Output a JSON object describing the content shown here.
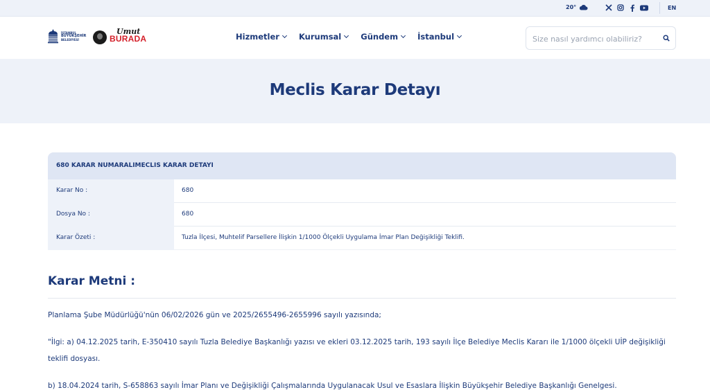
{
  "topbar": {
    "temperature": "20°",
    "weather_icon": "cloud-icon",
    "social_icons": [
      "x-icon",
      "instagram-icon",
      "facebook-icon",
      "youtube-icon"
    ],
    "language": "EN"
  },
  "header": {
    "logo_line1": "İSTANBUL",
    "logo_line2": "BÜYÜKŞEHİR",
    "logo_line3": "BELEDİYESİ",
    "brand_top": "Umut",
    "brand_bottom": "BURADA",
    "nav": [
      "Hizmetler",
      "Kurumsal",
      "Gündem",
      "İstanbul"
    ],
    "search_placeholder": "Size nasıl yardımcı olabiliriz?"
  },
  "hero": {
    "title": "Meclis Karar Detayı"
  },
  "decision": {
    "heading": "680 KARAR NUMARALIMECLIS KARAR DETAYI",
    "rows": [
      {
        "label": "Karar No :",
        "value": "680"
      },
      {
        "label": "Dosya No :",
        "value": "680"
      },
      {
        "label": "Karar Özeti :",
        "value": "Tuzla İlçesi, Muhtelif Parsellere İlişkin 1/1000 Ölçekli Uygulama İmar Plan Değişikliği Teklifi."
      }
    ]
  },
  "text": {
    "title": "Karar Metni :",
    "p1": "Planlama Şube Müdürlüğü'nün 06/02/2026 gün ve 2025/2655496-2655996 sayılı yazısında;",
    "p2": "\"İlgi: a) 04.12.2025 tarih, E-350410 sayılı Tuzla Belediye Başkanlığı yazısı ve ekleri 03.12.2025 tarih, 193 sayılı İlçe Belediye Meclis Kararı ile 1/1000 ölçekli UİP değişikliği teklifi dosyası.",
    "p3": "b) 18.04.2024 tarih, S-658863 sayılı İmar Planı ve Değişikliği Çalışmalarında Uygulanacak Usul ve Esaslara İlişkin Büyükşehir Belediye Başkanlığı Genelgesi."
  },
  "colors": {
    "primary": "#1d3a7a",
    "hero_bg": "#eef2f9",
    "table_head": "#dfe6f4",
    "brand_red": "#d4202a"
  }
}
